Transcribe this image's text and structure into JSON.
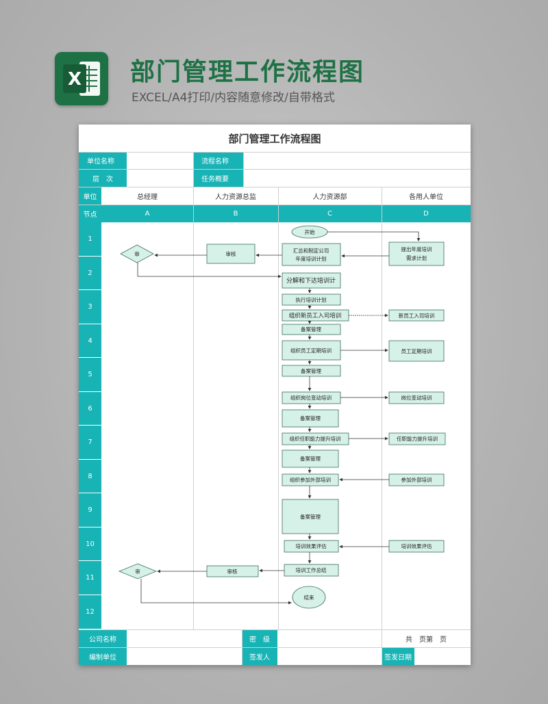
{
  "header": {
    "title": "部门管理工作流程图",
    "subtitle": "EXCEL/A4打印/内容随意修改/自带格式",
    "logo_letter": "X"
  },
  "sheet": {
    "title": "部门管理工作流程图",
    "info": {
      "unit_name_label": "单位名称",
      "process_name_label": "流程名称",
      "level_label": "层　次",
      "task_label": "任务概要"
    },
    "unit_label": "单位",
    "node_label": "节点",
    "columns": [
      "总经理",
      "人力资源总监",
      "人力资源部",
      "各用人单位"
    ],
    "column_letters": [
      "A",
      "B",
      "C",
      "D"
    ],
    "rows": [
      "1",
      "2",
      "3",
      "4",
      "5",
      "6",
      "7",
      "8",
      "9",
      "10",
      "11",
      "12"
    ],
    "footer": {
      "company_label": "公司名称",
      "secret_label": "密　级",
      "pages_text": "共　页第　页",
      "editor_label": "编制单位",
      "issuer_label": "签发人",
      "issue_date_label": "签发日期"
    }
  },
  "flow": {
    "start": "开始",
    "approve_review": "审核",
    "approve": "审",
    "summarize_plan": "汇总和制定公司",
    "summarize_plan_2": "年度培训计划",
    "propose_need": "提出年度培训",
    "propose_need_2": "需求计划",
    "decompose": "分解和下达培训计",
    "execute": "执行培训计划",
    "new_staff": "组织新员工入司培训",
    "new_staff_d": "新员工入司培训",
    "record": "备案管理",
    "periodic": "组织员工定期培训",
    "periodic_d": "员工定期培训",
    "position_change": "组织岗位变动培训",
    "position_change_d": "岗位变动培训",
    "ability": "组织任职能力提升培训",
    "ability_d": "任职能力提升培训",
    "external": "组织参加外部培训",
    "external_d": "参加外部培训",
    "effect": "培训效果评估",
    "summary": "培训工作总结",
    "end": "结束"
  },
  "colors": {
    "teal": "#17b3b5",
    "box_fill": "#d6f1e7",
    "brand_green": "#1e7145"
  }
}
